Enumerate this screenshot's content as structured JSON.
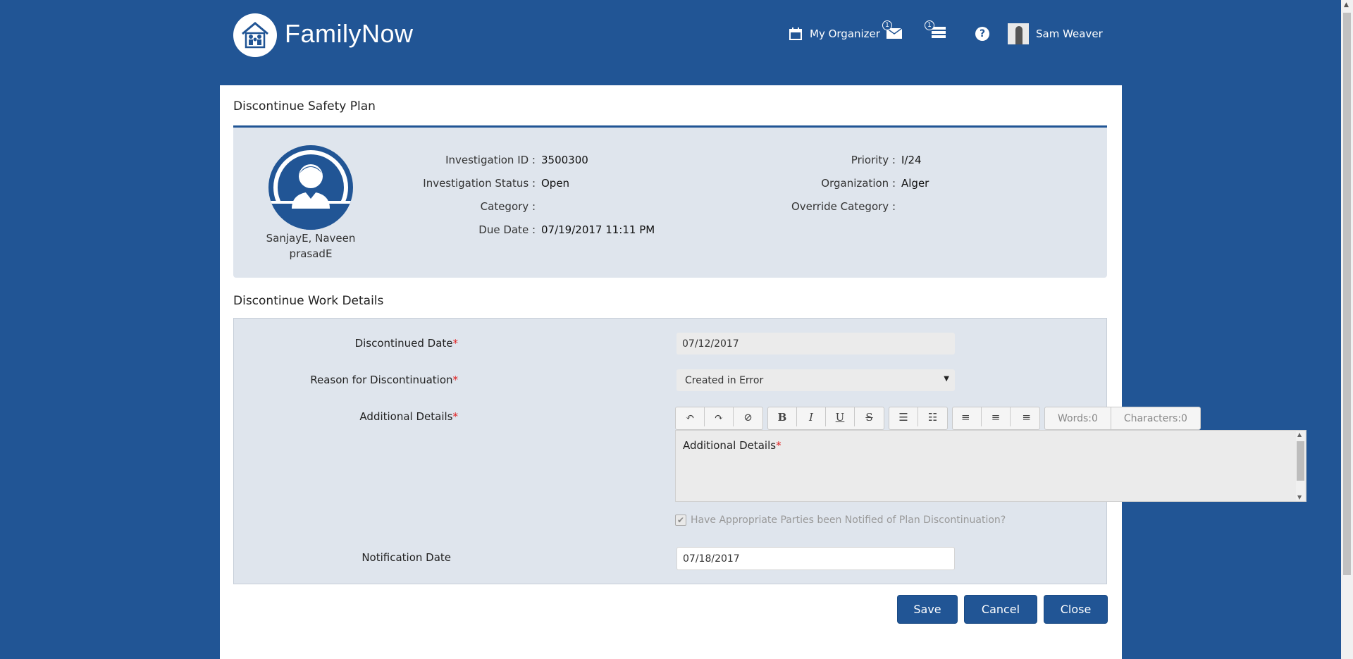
{
  "header": {
    "brand": "FamilyNow",
    "organizer_label": "My Organizer",
    "mail_count": "1",
    "tasks_count": "1",
    "help_label": "?",
    "user_name": "Sam Weaver"
  },
  "panel": {
    "title": "Discontinue Safety Plan",
    "person_name": "SanjayE, Naveen prasadE",
    "info": {
      "investigation_id_label": "Investigation ID :",
      "investigation_id": "3500300",
      "status_label": "Investigation Status :",
      "status": "Open",
      "category_label": "Category :",
      "category": "",
      "due_date_label": "Due Date :",
      "due_date": "07/19/2017 11:11 PM",
      "priority_label": "Priority :",
      "priority": "I/24",
      "organization_label": "Organization :",
      "organization": "Alger",
      "override_category_label": "Override Category :",
      "override_category": ""
    },
    "section_title": "Discontinue Work Details",
    "form": {
      "discontinued_date_label": "Discontinued Date",
      "discontinued_date": "07/12/2017",
      "reason_label": "Reason for Discontinuation",
      "reason": "Created in Error",
      "additional_details_label": "Additional Details",
      "toolbar": {
        "undo": "↶",
        "redo": "↷",
        "clear": "⊘",
        "bold": "B",
        "italic": "I",
        "underline": "U",
        "strike": "S",
        "bullets": "☰",
        "numbers": "☷",
        "align_left": "≡",
        "align_center": "≡",
        "align_right": "≡"
      },
      "words_label": "Words:0",
      "characters_label": "Characters:0",
      "editor_placeholder": "Additional Details",
      "notified_label": "Have Appropriate Parties been Notified of Plan Discontinuation?",
      "notified_checked": true,
      "notification_date_label": "Notification Date",
      "notification_date": "07/18/2017"
    },
    "buttons": {
      "save": "Save",
      "cancel": "Cancel",
      "close": "Close"
    }
  },
  "colors": {
    "brand_blue": "#215595",
    "info_bg": "#dfe5ed",
    "required": "#e02020"
  }
}
